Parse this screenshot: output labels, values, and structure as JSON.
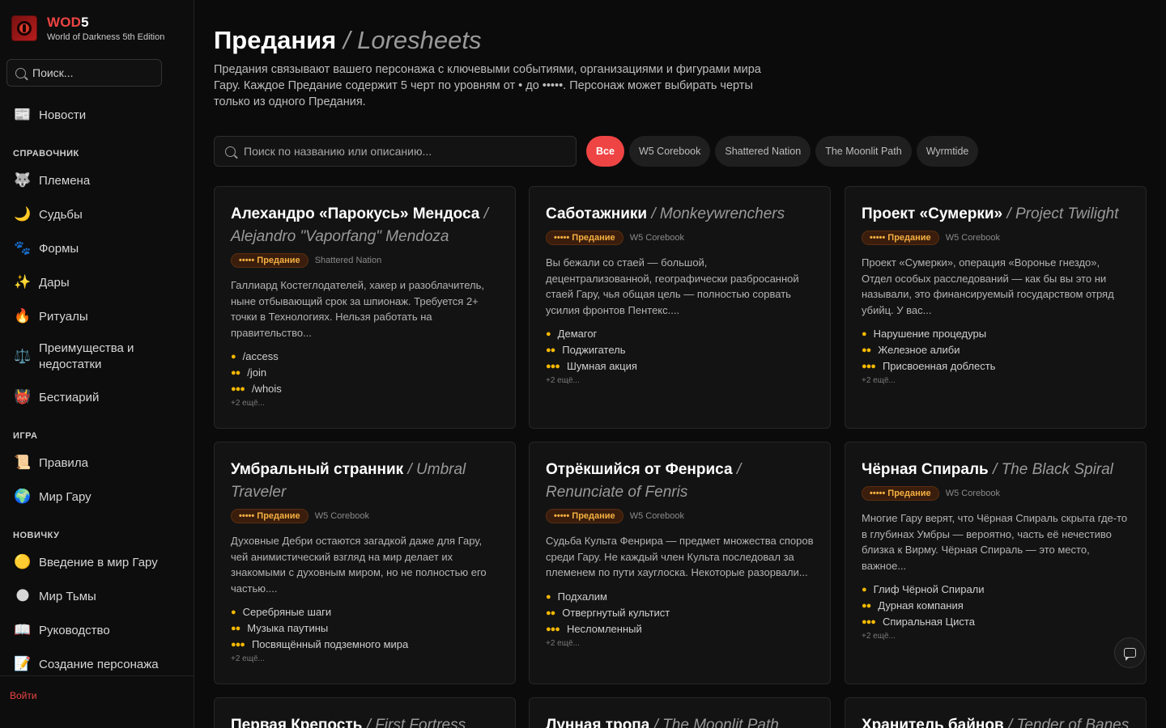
{
  "sidebar": {
    "brand_name_red": "WOD",
    "brand_name_white": "5",
    "brand_sub": "World of Darkness 5th Edition",
    "search_placeholder": "Поиск...",
    "news": {
      "icon": "📰",
      "label": "Новости"
    },
    "section_reference": "СПРАВОЧНИК",
    "reference_items": [
      {
        "icon": "🐺",
        "label": "Племена"
      },
      {
        "icon": "🌙",
        "label": "Судьбы"
      },
      {
        "icon": "🐾",
        "label": "Формы"
      },
      {
        "icon": "✨",
        "label": "Дары"
      },
      {
        "icon": "🔥",
        "label": "Ритуалы"
      },
      {
        "icon": "⚖️",
        "label": "Преимущества и недостатки"
      },
      {
        "icon": "👹",
        "label": "Бестиарий"
      }
    ],
    "section_game": "ИГРА",
    "game_items": [
      {
        "icon": "📜",
        "label": "Правила"
      },
      {
        "icon": "🌍",
        "label": "Мир Гару"
      }
    ],
    "section_newbie": "НОВИЧКУ",
    "newbie_items": [
      {
        "icon": "🟡",
        "label": "Введение в мир Гару"
      },
      {
        "icon": "🌑",
        "label": "Мир Тьмы"
      },
      {
        "icon": "📖",
        "label": "Руководство"
      },
      {
        "icon": "📝",
        "label": "Создание персонажа"
      }
    ],
    "login": "Войти"
  },
  "header": {
    "title_ru": "Предания",
    "title_en": "/ Loresheets",
    "description": "Предания связывают вашего персонажа с ключевыми событиями, организациями и фигурами мира Гару. Каждое Предание содержит 5 черт по уровням от • до •••••. Персонаж может выбирать черты только из одного Предания."
  },
  "search": {
    "placeholder": "Поиск по названию или описанию..."
  },
  "filters": [
    "Все",
    "W5 Corebook",
    "Shattered Nation",
    "The Moonlit Path",
    "Wyrmtide"
  ],
  "cards": [
    {
      "title_ru": "Алехандро «Парокусь» Мендоса",
      "title_en": "/ Alejandro \"Vaporfang\" Mendoza",
      "badge": "••••• Предание",
      "source": "Shattered Nation",
      "description": "Галлиард Костеглодателей, хакер и разоблачитель, ныне отбывающий срок за шпионаж. Требуется 2+ точки в Технологиях. Нельзя работать на правительство...",
      "traits": [
        {
          "dots": "●",
          "name": "/access"
        },
        {
          "dots": "●●",
          "name": "/join"
        },
        {
          "dots": "●●●",
          "name": "/whois"
        }
      ],
      "more": "+2 ещё..."
    },
    {
      "title_ru": "Саботажники",
      "title_en": "/ Monkeywrenchers",
      "badge": "••••• Предание",
      "source": "W5 Corebook",
      "description": "Вы бежали со стаей — большой, децентрализованной, географически разбросанной стаей Гару, чья общая цель — полностью сорвать усилия фронтов Пентекс....",
      "traits": [
        {
          "dots": "●",
          "name": "Демагог"
        },
        {
          "dots": "●●",
          "name": "Поджигатель"
        },
        {
          "dots": "●●●",
          "name": "Шумная акция"
        }
      ],
      "more": "+2 ещё..."
    },
    {
      "title_ru": "Проект «Сумерки»",
      "title_en": "/ Project Twilight",
      "badge": "••••• Предание",
      "source": "W5 Corebook",
      "description": "Проект «Сумерки», операция «Воронье гнездо», Отдел особых расследований — как бы вы это ни называли, это финансируемый государством отряд убийц. У вас...",
      "traits": [
        {
          "dots": "●",
          "name": "Нарушение процедуры"
        },
        {
          "dots": "●●",
          "name": "Железное алиби"
        },
        {
          "dots": "●●●",
          "name": "Присвоенная доблесть"
        }
      ],
      "more": "+2 ещё..."
    },
    {
      "title_ru": "Умбральный странник",
      "title_en": "/ Umbral Traveler",
      "badge": "••••• Предание",
      "source": "W5 Corebook",
      "description": "Духовные Дебри остаются загадкой даже для Гару, чей анимистический взгляд на мир делает их знакомыми с духовным миром, но не полностью его частью....",
      "traits": [
        {
          "dots": "●",
          "name": "Серебряные шаги"
        },
        {
          "dots": "●●",
          "name": "Музыка паутины"
        },
        {
          "dots": "●●●",
          "name": "Посвящённый подземного мира"
        }
      ],
      "more": "+2 ещё..."
    },
    {
      "title_ru": "Отрёкшийся от Фенриса",
      "title_en": "/ Renunciate of Fenris",
      "badge": "••••• Предание",
      "source": "W5 Corebook",
      "description": "Судьба Культа Фенрира — предмет множества споров среди Гару. Не каждый член Культа последовал за племенем по пути хауглоска. Некоторые разорвали...",
      "traits": [
        {
          "dots": "●",
          "name": "Подхалим"
        },
        {
          "dots": "●●",
          "name": "Отвергнутый культист"
        },
        {
          "dots": "●●●",
          "name": "Несломленный"
        }
      ],
      "more": "+2 ещё..."
    },
    {
      "title_ru": "Чёрная Спираль",
      "title_en": "/ The Black Spiral",
      "badge": "••••• Предание",
      "source": "W5 Corebook",
      "description": "Многие Гару верят, что Чёрная Спираль скрыта где-то в глубинах Умбры — вероятно, часть её нечестиво близка к Вирму. Чёрная Спираль — это место, важное...",
      "traits": [
        {
          "dots": "●",
          "name": "Глиф Чёрной Спирали"
        },
        {
          "dots": "●●",
          "name": "Дурная компания"
        },
        {
          "dots": "●●●",
          "name": "Спиральная Циста"
        }
      ],
      "more": "+2 ещё..."
    },
    {
      "title_ru": "Первая Крепость",
      "title_en": "/ First Fortress"
    },
    {
      "title_ru": "Лунная тропа",
      "title_en": "/ The Moonlit Path"
    },
    {
      "title_ru": "Хранитель байнов",
      "title_en": "/ Tender of Banes"
    }
  ]
}
